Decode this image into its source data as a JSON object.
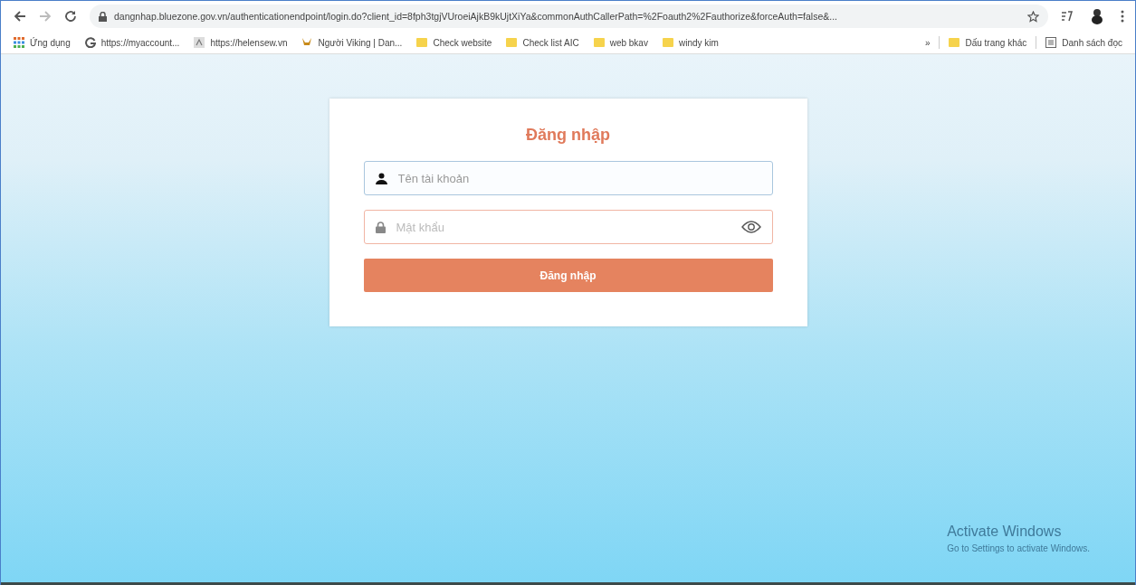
{
  "browser": {
    "url": "dangnhap.bluezone.gov.vn/authenticationendpoint/login.do?client_id=8fph3tgjVUroeiAjkB9kUjtXiYa&commonAuthCallerPath=%2Foauth2%2Fauthorize&forceAuth=false&..."
  },
  "bookmarks": [
    {
      "label": "Ứng dụng",
      "kind": "apps"
    },
    {
      "label": "https://myaccount...",
      "kind": "google"
    },
    {
      "label": "https://helensew.vn",
      "kind": "site"
    },
    {
      "label": "Người Viking | Dan...",
      "kind": "viking"
    },
    {
      "label": "Check website",
      "kind": "folder"
    },
    {
      "label": "Check list AIC",
      "kind": "folder"
    },
    {
      "label": "web bkav",
      "kind": "folder"
    },
    {
      "label": "windy kim",
      "kind": "folder"
    }
  ],
  "bookmarks_overflow": "»",
  "other_bookmarks": "Dấu trang khác",
  "reading_list": "Danh sách đọc",
  "login": {
    "title": "Đăng nhập",
    "fields": [
      {
        "kind": "user",
        "placeholder": "Tên tài khoản",
        "focused": true,
        "invalid": false
      },
      {
        "kind": "password",
        "placeholder": "Mật khẩu",
        "focused": false,
        "invalid": true
      }
    ],
    "button": "Đăng nhập"
  },
  "activation_notice": {
    "title": "Activate Windows",
    "subtitle": "Go to Settings to activate Windows."
  }
}
